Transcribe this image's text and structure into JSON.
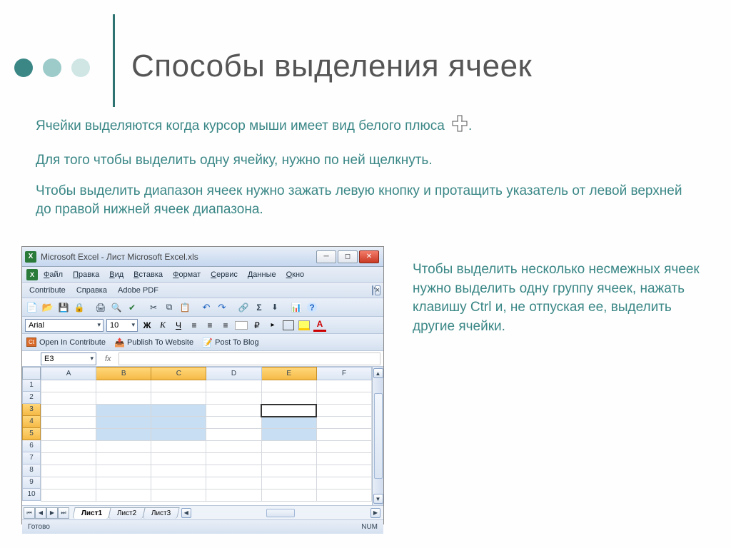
{
  "title": "Способы выделения ячеек",
  "para1": "Ячейки выделяются когда курсор мыши имеет вид белого плюса",
  "para2": "Для того чтобы выделить одну ячейку, нужно по ней щелкнуть.",
  "para3": "Чтобы выделить диапазон ячеек нужно зажать левую кнопку и протащить указатель от левой верхней до правой нижней ячеек диапазона.",
  "para4": "Чтобы выделить несколько несмежных ячеек нужно выделить одну группу ячеек, нажать клавишу Ctrl и, не отпуская ее, выделить другие ячейки.",
  "excel": {
    "title": "Microsoft Excel - Лист Microsoft Excel.xls",
    "menus": [
      "Файл",
      "Правка",
      "Вид",
      "Вставка",
      "Формат",
      "Сервис",
      "Данные",
      "Окно"
    ],
    "row2": {
      "contribute": "Contribute",
      "help": "Справка",
      "adobe": "Adobe PDF"
    },
    "font": "Arial",
    "fontsize": "10",
    "fmt": {
      "bold": "Ж",
      "italic": "К",
      "underline": "Ч",
      "fontcolor": "A"
    },
    "contrib": {
      "open": "Open In Contribute",
      "publish": "Publish To Website",
      "post": "Post To Blog"
    },
    "namebox": "E3",
    "fx": "fx",
    "cols": [
      "A",
      "B",
      "C",
      "D",
      "E",
      "F"
    ],
    "rows": [
      "1",
      "2",
      "3",
      "4",
      "5",
      "6",
      "7",
      "8",
      "9",
      "10"
    ],
    "tabs": [
      "Лист1",
      "Лист2",
      "Лист3"
    ],
    "status_left": "Готово",
    "status_right": "NUM"
  }
}
